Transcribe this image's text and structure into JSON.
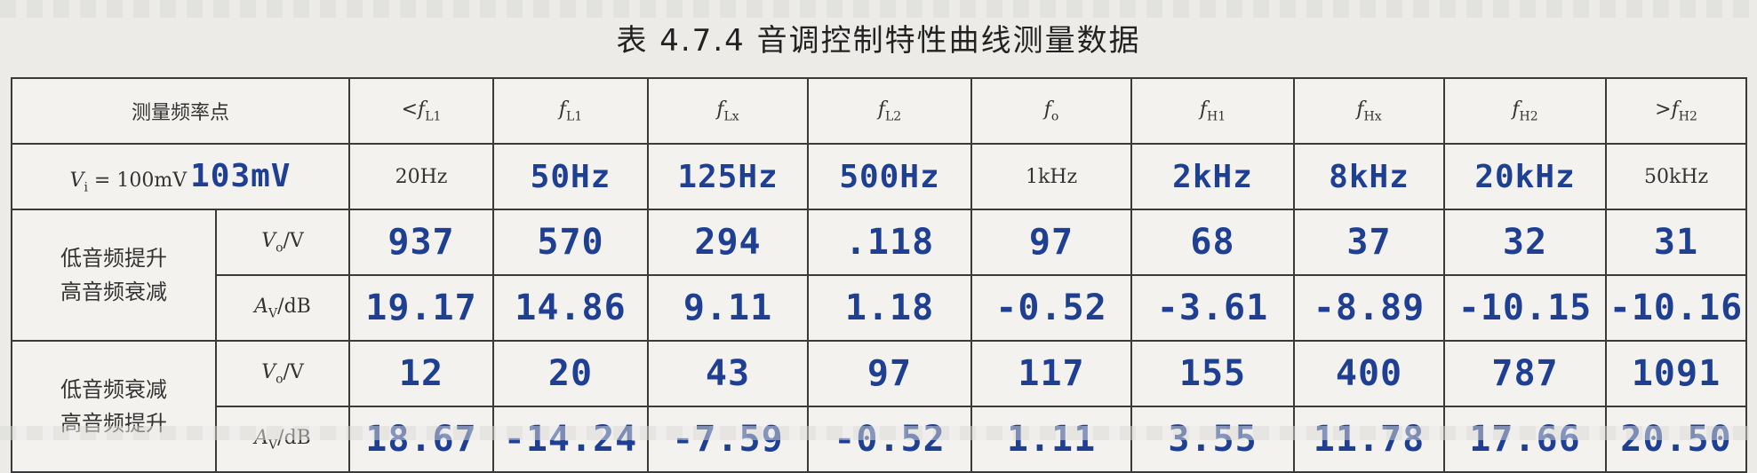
{
  "title": "表 4.7.4   音调控制特性曲线测量数据",
  "header": {
    "label": "测量频率点",
    "cols": [
      {
        "pre": "<",
        "main": "f",
        "sub": "L1"
      },
      {
        "pre": "",
        "main": "f",
        "sub": "L1"
      },
      {
        "pre": "",
        "main": "f",
        "sub": "Lx"
      },
      {
        "pre": "",
        "main": "f",
        "sub": "L2"
      },
      {
        "pre": "",
        "main": "f",
        "sub": "o"
      },
      {
        "pre": "",
        "main": "f",
        "sub": "H1"
      },
      {
        "pre": "",
        "main": "f",
        "sub": "Hx"
      },
      {
        "pre": "",
        "main": "f",
        "sub": "H2"
      },
      {
        "pre": ">",
        "main": "f",
        "sub": "H2"
      }
    ]
  },
  "vi_row": {
    "label_main": "V",
    "label_sub": "i",
    "label_rest": " = 100mV",
    "handwritten_note": "103mV",
    "freqs": [
      {
        "text": "20Hz",
        "handwritten": false
      },
      {
        "text": "50Hz",
        "handwritten": true
      },
      {
        "text": "125Hz",
        "handwritten": true
      },
      {
        "text": "500Hz",
        "handwritten": true
      },
      {
        "text": "1kHz",
        "handwritten": false
      },
      {
        "text": "2kHz",
        "handwritten": true
      },
      {
        "text": "8kHz",
        "handwritten": true
      },
      {
        "text": "20kHz",
        "handwritten": true
      },
      {
        "text": "50kHz",
        "handwritten": false
      }
    ]
  },
  "groups": [
    {
      "line1": "低音频提升",
      "line2": "高音频衰减",
      "rows": [
        {
          "q_main": "V",
          "q_sub": "o",
          "q_rest": "/V",
          "values": [
            "937",
            "570",
            "294",
            ".118",
            "97",
            "68",
            "37",
            "32",
            "31"
          ]
        },
        {
          "q_main": "A",
          "q_sub": "V",
          "q_rest": "/dB",
          "values": [
            "19.17",
            "14.86",
            "9.11",
            "1.18",
            "-0.52",
            "-3.61",
            "-8.89",
            "-10.15",
            "-10.16"
          ]
        }
      ]
    },
    {
      "line1": "低音频衰减",
      "line2": "高音频提升",
      "rows": [
        {
          "q_main": "V",
          "q_sub": "o",
          "q_rest": "/V",
          "values": [
            "12",
            "20",
            "43",
            "97",
            "117",
            "155",
            "400",
            "787",
            "1091"
          ]
        },
        {
          "q_main": "A",
          "q_sub": "V",
          "q_rest": "/dB",
          "values": [
            "18.67",
            "-14.24",
            "-7.59",
            "-0.52",
            "1.11",
            "3.55",
            "11.78",
            "17.66",
            "20.50"
          ]
        }
      ]
    }
  ],
  "colors": {
    "handwriting": "#1f3f93",
    "ink": "#2b2b2b",
    "paper": "#ecebe8"
  }
}
